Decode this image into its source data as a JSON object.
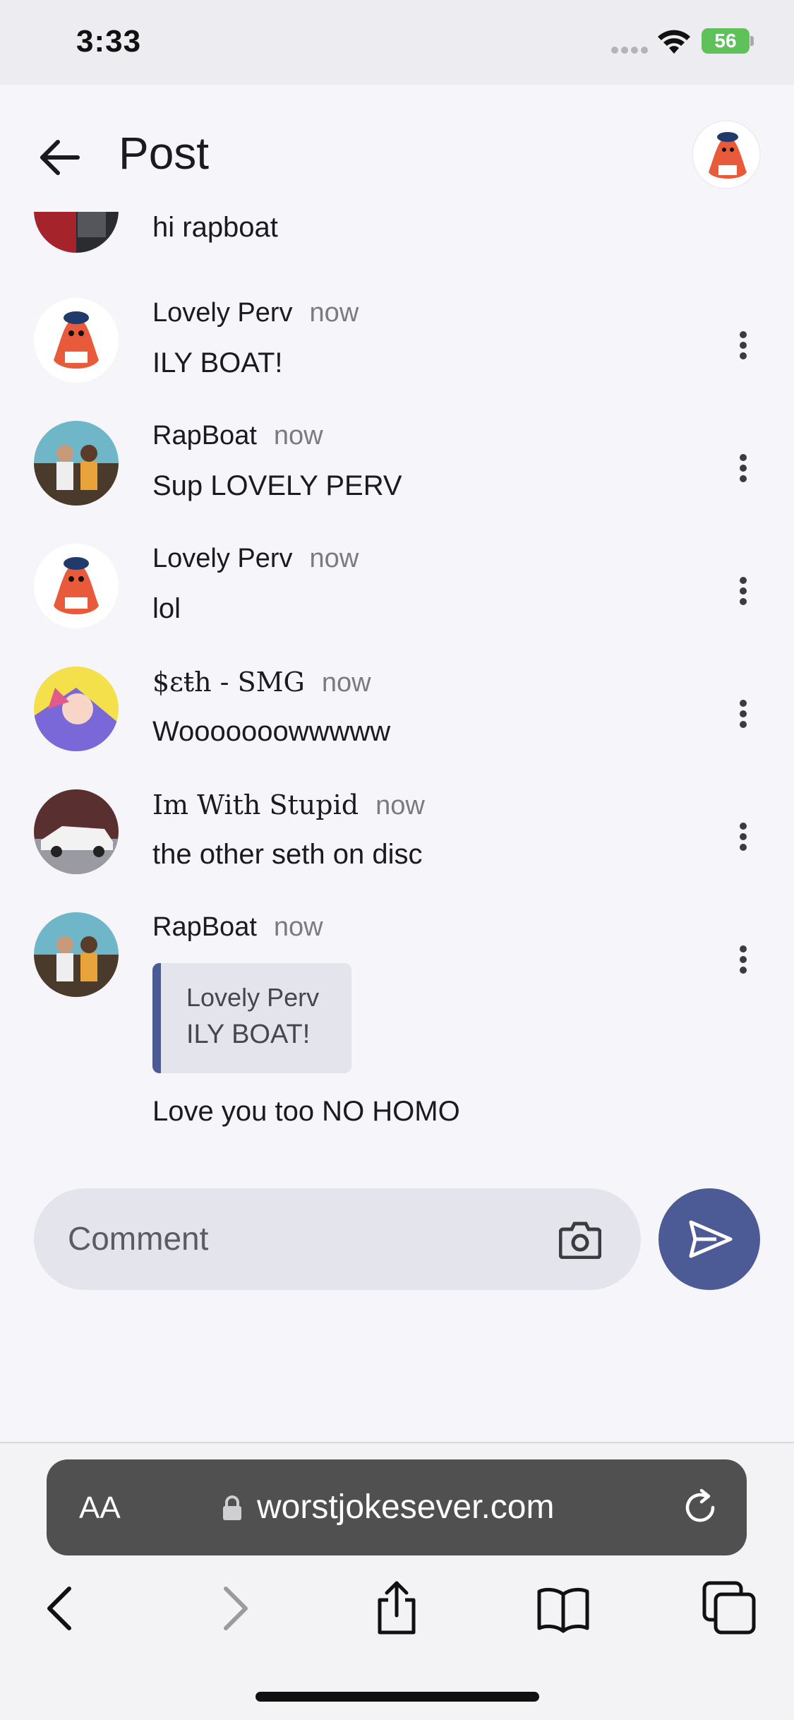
{
  "status_bar": {
    "time": "3:33",
    "battery": "56"
  },
  "header": {
    "title": "Post"
  },
  "comments": [
    {
      "author": "",
      "time": "",
      "text": "hi rapboat"
    },
    {
      "author": "Lovely Perv",
      "time": "now",
      "text": "ILY BOAT!"
    },
    {
      "author": "RapBoat",
      "time": "now",
      "text": "Sup LOVELY PERV"
    },
    {
      "author": "Lovely Perv",
      "time": "now",
      "text": "lol"
    },
    {
      "author": "$εŧh - SMG",
      "time": "now",
      "text": "Wooooooowwwww"
    },
    {
      "author": "Im With Stupid",
      "time": "now",
      "text": "the other seth on disc"
    },
    {
      "author": "RapBoat",
      "time": "now",
      "quote": {
        "author": "Lovely Perv",
        "text": "ILY BOAT!"
      },
      "text": "Love you too NO HOMO"
    }
  ],
  "composer": {
    "placeholder": "Comment"
  },
  "safari": {
    "aa_label": "AA",
    "url": "worstjokesever.com"
  },
  "colors": {
    "accent": "#4c5a96",
    "background": "#f6f6fa",
    "input_bg": "#e4e4ec",
    "address_bar": "#505051",
    "battery": "#5fc15a"
  },
  "icons": {
    "back": "arrow-left-icon",
    "more": "vertical-dots-icon",
    "camera": "camera-icon",
    "send": "send-icon",
    "lock": "lock-icon",
    "reload": "reload-icon",
    "nav_back": "chevron-left-icon",
    "nav_forward": "chevron-right-icon",
    "share": "share-icon",
    "bookmarks": "book-icon",
    "tabs": "tabs-icon"
  }
}
